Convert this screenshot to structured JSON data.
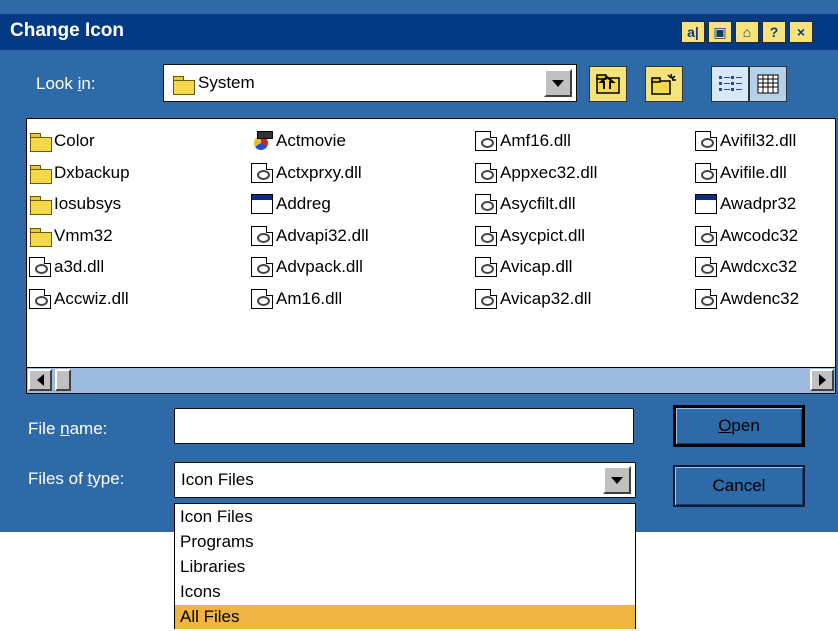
{
  "window": {
    "title": "Change Icon",
    "title_buttons": [
      "a|",
      "▣",
      "⌂",
      "?",
      "×"
    ]
  },
  "lookin": {
    "label_pre": "Look ",
    "label_accel": "i",
    "label_post": "n:",
    "value": "System"
  },
  "files": [
    {
      "name": "Color",
      "type": "folder"
    },
    {
      "name": "Dxbackup",
      "type": "folder"
    },
    {
      "name": "Iosubsys",
      "type": "folder"
    },
    {
      "name": "Vmm32",
      "type": "folder"
    },
    {
      "name": "a3d.dll",
      "type": "dll"
    },
    {
      "name": "Accwiz.dll",
      "type": "dll"
    },
    {
      "name": "Actmovie",
      "type": "movie"
    },
    {
      "name": "Actxprxy.dll",
      "type": "dll"
    },
    {
      "name": "Addreg",
      "type": "exe"
    },
    {
      "name": "Advapi32.dll",
      "type": "dll"
    },
    {
      "name": "Advpack.dll",
      "type": "dll"
    },
    {
      "name": "Am16.dll",
      "type": "dll"
    },
    {
      "name": "Amf16.dll",
      "type": "dll"
    },
    {
      "name": "Appxec32.dll",
      "type": "dll"
    },
    {
      "name": "Asycfilt.dll",
      "type": "dll"
    },
    {
      "name": "Asycpict.dll",
      "type": "dll"
    },
    {
      "name": "Avicap.dll",
      "type": "dll"
    },
    {
      "name": "Avicap32.dll",
      "type": "dll"
    },
    {
      "name": "Avifil32.dll",
      "type": "dll"
    },
    {
      "name": "Avifile.dll",
      "type": "dll"
    },
    {
      "name": "Awadpr32",
      "type": "exe"
    },
    {
      "name": "Awcodc32",
      "type": "dll"
    },
    {
      "name": "Awdcxc32",
      "type": "dll"
    },
    {
      "name": "Awdenc32",
      "type": "dll"
    }
  ],
  "filename": {
    "label_pre": "File ",
    "label_accel": "n",
    "label_post": "ame:",
    "value": ""
  },
  "filetype": {
    "label_pre": "Files of ",
    "label_accel": "t",
    "label_post": "ype:",
    "value": "Icon Files",
    "options": [
      "Icon Files",
      "Programs",
      "Libraries",
      "Icons",
      "All Files"
    ],
    "highlighted": "All Files"
  },
  "buttons": {
    "open_accel": "O",
    "open_rest": "pen",
    "cancel": "Cancel"
  },
  "colors": {
    "dialog_bg": "#2f6aa8",
    "titlebar": "#043a83",
    "highlight": "#f1b341",
    "toolbar_button": "#f6e37b"
  }
}
